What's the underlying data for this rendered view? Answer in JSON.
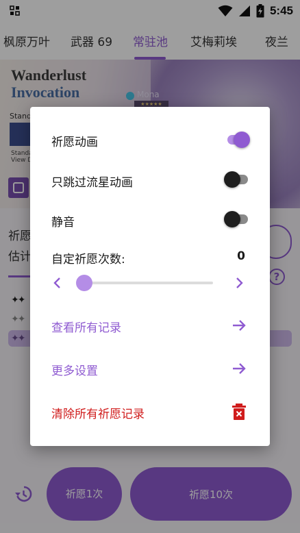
{
  "status_bar": {
    "time": "5:45"
  },
  "tabs": [
    {
      "label": "枫原万叶",
      "active": false
    },
    {
      "label": "武器 69",
      "active": false
    },
    {
      "label": "常驻池",
      "active": true
    },
    {
      "label": "艾梅莉埃",
      "active": false
    },
    {
      "label": "夜兰",
      "active": false
    }
  ],
  "banner": {
    "title_line1": "Wanderlust",
    "title_line2": "Invocation",
    "standard_text": "Stand",
    "small_text_1": "Standa",
    "small_text_2": "View D",
    "character_name": "Mona",
    "stars": "★★★★★"
  },
  "background": {
    "label_1": "祈愿",
    "label_2": "估计",
    "star_rows": [
      "✦✦",
      "✦✦",
      "✦✦"
    ]
  },
  "bottom": {
    "pull_one_label": "祈愿1次",
    "pull_ten_label": "祈愿10次"
  },
  "dialog": {
    "wish_animation": {
      "label": "祈愿动画",
      "on": true
    },
    "skip_meteor": {
      "label": "只跳过流星动画",
      "on": false
    },
    "mute": {
      "label": "静音",
      "on": false
    },
    "custom_count": {
      "label": "自定祈愿次数:",
      "value": "0",
      "slider_fraction": 0
    },
    "view_all_records": "查看所有记录",
    "more_settings": "更多设置",
    "clear_all_records": "清除所有祈愿记录"
  },
  "colors": {
    "accent": "#8f5bd1",
    "accent_light": "#b48de6",
    "danger": "#d01c1c",
    "scrim": "rgba(0,0,0,0.38)"
  }
}
